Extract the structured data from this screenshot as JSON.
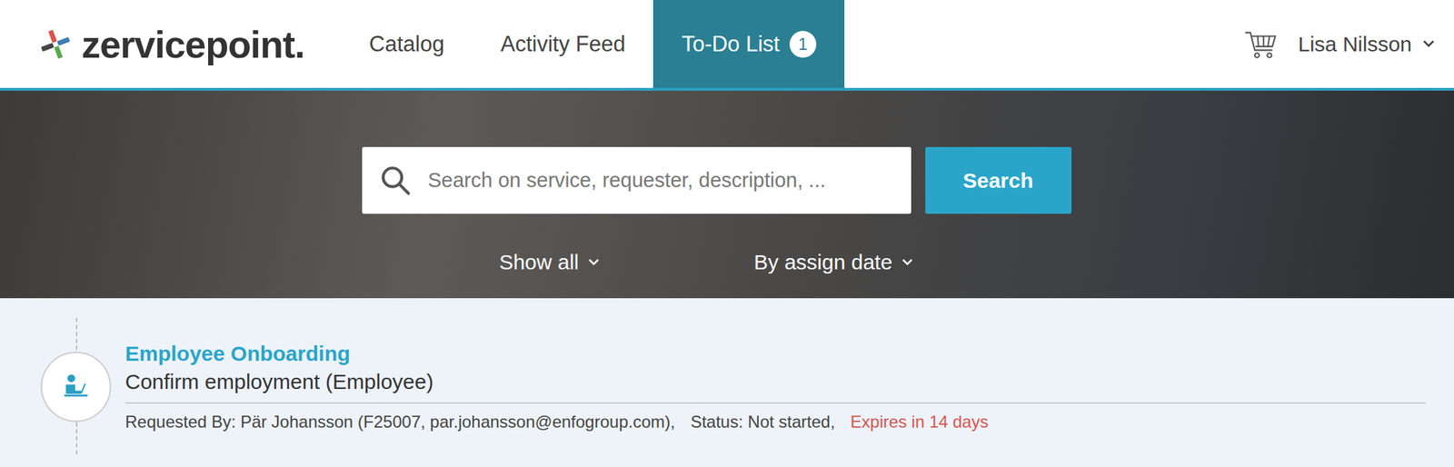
{
  "header": {
    "logo": "zervicepoint.",
    "nav": [
      {
        "label": "Catalog",
        "selected": false
      },
      {
        "label": "Activity Feed",
        "selected": false
      },
      {
        "label": "To-Do List",
        "selected": true,
        "badge": "1"
      }
    ],
    "user": "Lisa Nilsson"
  },
  "search": {
    "placeholder": "Search on service, requester, description, ...",
    "button": "Search"
  },
  "filters": {
    "show": "Show all",
    "sort": "By assign date"
  },
  "tasks": [
    {
      "service": "Employee Onboarding",
      "task": "Confirm employment (Employee)",
      "requested_by": "Requested By: Pär Johansson (F25007, par.johansson@enfogroup.com),",
      "status": "Status: Not started,",
      "expires": "Expires in 14 days"
    }
  ]
}
